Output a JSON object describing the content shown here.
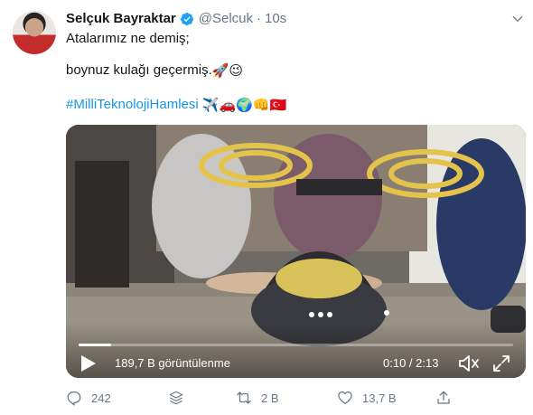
{
  "tweet": {
    "author_name": "Selçuk Bayraktar",
    "handle": "@Selcuk",
    "separator": "·",
    "time": "10s",
    "line1": "Atalarımız ne demiş;",
    "line2": "boynuz kulağı geçermiş.",
    "line2_emojis": "🚀😉",
    "hashtag": "#MilliTeknolojiHamlesi",
    "hashtag_emojis": "✈️🚗🌍👊🇹🇷"
  },
  "video": {
    "views": "189,7 B görüntülenme",
    "time_display": "0:10 / 2:13",
    "progress": 0.075
  },
  "actions": {
    "replies": "242",
    "retweets": "2 B",
    "likes": "13,7 B"
  },
  "icons": {
    "verified": "verified-badge-icon",
    "more": "chevron-down-icon",
    "play": "play-icon",
    "mute": "mute-icon",
    "expand": "expand-icon",
    "reply": "reply-icon",
    "stack": "stack-icon",
    "retweet": "retweet-icon",
    "like": "heart-icon",
    "share": "share-icon"
  },
  "colors": {
    "link": "#1b95e0",
    "verified": "#1da1f2",
    "muted_text": "#657786"
  }
}
